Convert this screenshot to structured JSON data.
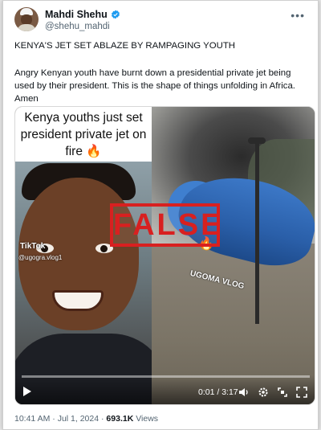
{
  "author": {
    "display_name": "Mahdi Shehu",
    "handle": "@shehu_mahdi",
    "verified_icon": "verified-badge-icon"
  },
  "post": {
    "headline": "KENYA'S JET SET ABLAZE BY RAMPAGING YOUTH",
    "body": "Angry Kenyan youth have burnt down a presidential private jet being used by their president. This is the shape of things unfolding in Africa. Amen"
  },
  "media": {
    "overlay_caption": "Kenya youths just set president private jet on fire",
    "caption_emoji": "🔥",
    "tiktok_label": "TikTok",
    "tiktok_user": "@ugogra.vlog1",
    "watermark": "UGOMA VLOG",
    "stamp": "FALSE",
    "time_display": "0:01 / 3:17"
  },
  "footer": {
    "timestamp": "10:41 AM · Jul 1, 2024",
    "views_count": "693.1K",
    "views_label": "Views"
  },
  "colors": {
    "stamp": "#d82020",
    "jet": "#2a5fa9",
    "verified": "#1d9bf0"
  }
}
